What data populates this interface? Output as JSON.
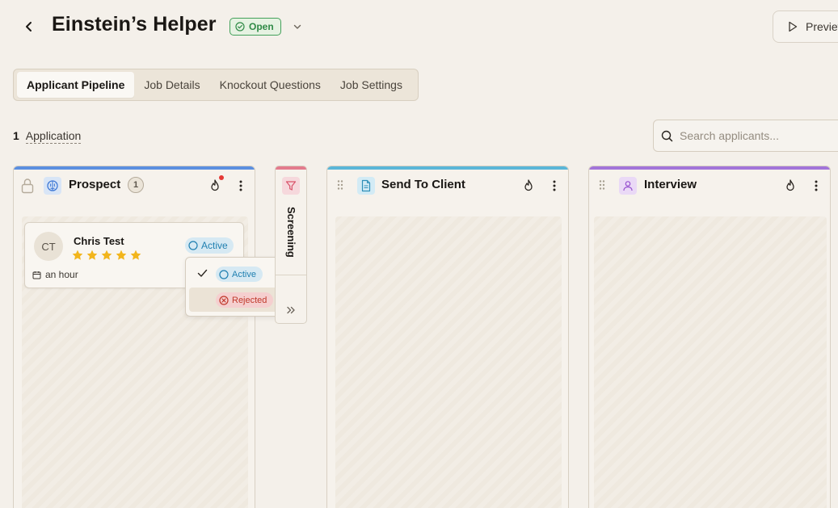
{
  "header": {
    "title": "Einstein’s Helper",
    "status": "Open",
    "preview_label": "Preview"
  },
  "tabs": [
    {
      "label": "Applicant Pipeline",
      "active": true
    },
    {
      "label": "Job Details",
      "active": false
    },
    {
      "label": "Knockout Questions",
      "active": false
    },
    {
      "label": "Job Settings",
      "active": false
    }
  ],
  "applications": {
    "count": "1",
    "label": "Application"
  },
  "search": {
    "placeholder": "Search applicants..."
  },
  "columns": [
    {
      "title": "Prospect",
      "count": "1",
      "color": "#5b8fe0"
    },
    {
      "title": "Screening",
      "color": "#e37b8d"
    },
    {
      "title": "Send To Client",
      "color": "#5ab6d8"
    },
    {
      "title": "Interview",
      "color": "#a274d9"
    }
  ],
  "card": {
    "initials": "CT",
    "name": "Chris Test",
    "rating": 5,
    "time": "an hour",
    "status": "Active"
  },
  "status_dropdown": {
    "options": [
      {
        "label": "Active",
        "selected": true
      },
      {
        "label": "Rejected",
        "selected": false
      }
    ]
  },
  "colors": {
    "background": "#f4f0ea",
    "open_green": "#2f8a46",
    "active_blue": "#1f7fb0",
    "rejected_red": "#c0392b",
    "star": "#f2b51c"
  }
}
